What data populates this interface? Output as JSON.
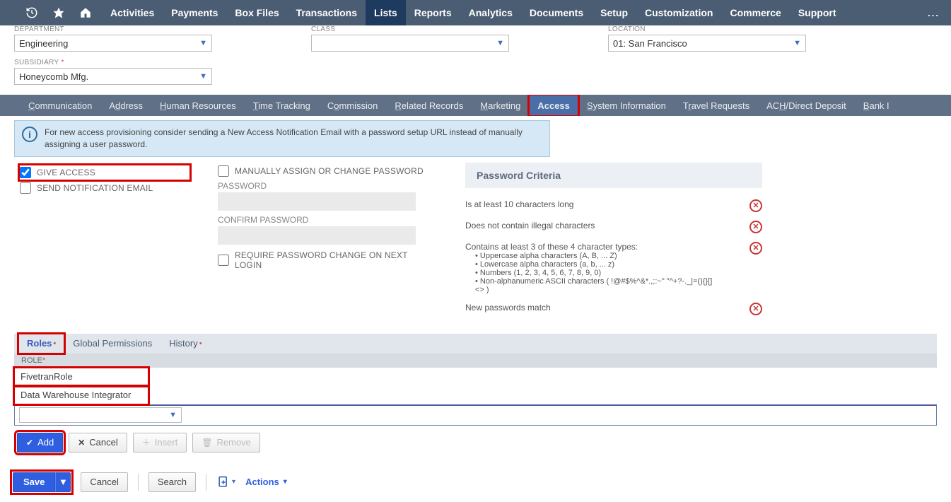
{
  "topnav": {
    "items": [
      "Activities",
      "Payments",
      "Box Files",
      "Transactions",
      "Lists",
      "Reports",
      "Analytics",
      "Documents",
      "Setup",
      "Customization",
      "Commerce",
      "Support"
    ],
    "active_index": 4,
    "more": "..."
  },
  "form": {
    "department": {
      "label": "DEPARTMENT",
      "value": "Engineering"
    },
    "class": {
      "label": "CLASS",
      "value": ""
    },
    "location": {
      "label": "LOCATION",
      "value": "01: San Francisco"
    },
    "subsidiary": {
      "label": "SUBSIDIARY",
      "required": true,
      "value": "Honeycomb Mfg."
    }
  },
  "subtabs": {
    "items": [
      "Communication",
      "Address",
      "Human Resources",
      "Time Tracking",
      "Commission",
      "Related Records",
      "Marketing",
      "Access",
      "System Information",
      "Travel Requests",
      "ACH/Direct Deposit",
      "Bank I"
    ],
    "active_index": 7,
    "highlight_index": 7
  },
  "info_banner": "For new access provisioning consider sending a New Access Notification Email with a password setup URL instead of manually assigning a user password.",
  "access": {
    "give_access": {
      "label": "GIVE ACCESS",
      "checked": true
    },
    "send_notification": {
      "label": "SEND NOTIFICATION EMAIL",
      "checked": false
    },
    "manually_assign": {
      "label": "MANUALLY ASSIGN OR CHANGE PASSWORD",
      "checked": false
    },
    "password_label": "PASSWORD",
    "confirm_password_label": "CONFIRM PASSWORD",
    "require_change": {
      "label": "REQUIRE PASSWORD CHANGE ON NEXT LOGIN",
      "checked": false
    }
  },
  "criteria": {
    "heading": "Password Criteria",
    "rows": [
      {
        "text": "Is at least 10 characters long",
        "fail": true
      },
      {
        "text": "Does not contain illegal characters",
        "fail": true
      },
      {
        "text": "Contains at least 3 of these 4 character types:",
        "fail": true,
        "sub": [
          "Uppercase alpha characters (A, B, ... Z)",
          "Lowercase alpha characters (a, b, ... z)",
          "Numbers (1, 2, 3, 4, 5, 6, 7, 8, 9, 0)",
          "Non-alphanumeric ASCII characters ( !@#$%^&*.,;:~\" \"^+?-._|=(){}[]<> )"
        ]
      },
      {
        "text": "New passwords match",
        "fail": true
      }
    ]
  },
  "roles": {
    "tabs": [
      {
        "label": "Roles",
        "dot": true
      },
      {
        "label": "Global Permissions"
      },
      {
        "label": "History",
        "dot": true
      }
    ],
    "active_tab": 0,
    "column_header": "ROLE",
    "rows": [
      "FivetranRole",
      "Data Warehouse Integrator"
    ],
    "buttons": {
      "add": "Add",
      "cancel": "Cancel",
      "insert": "Insert",
      "remove": "Remove"
    }
  },
  "footer": {
    "save": "Save",
    "cancel": "Cancel",
    "search": "Search",
    "actions": "Actions"
  }
}
